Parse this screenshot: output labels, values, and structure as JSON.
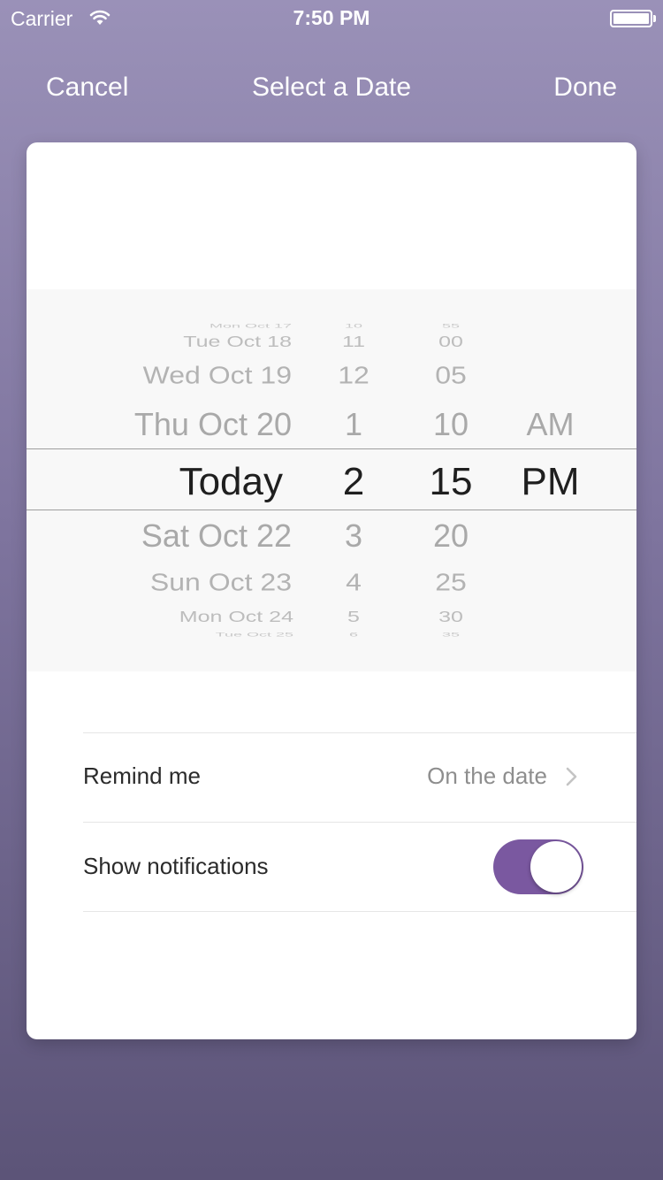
{
  "status_bar": {
    "carrier": "Carrier",
    "time": "7:50 PM",
    "wifi_icon": "wifi-icon",
    "battery_icon": "battery-icon"
  },
  "nav": {
    "cancel": "Cancel",
    "title": "Select a Date",
    "done": "Done"
  },
  "picker": {
    "dates": [
      "Mon Oct 17",
      "Tue Oct 18",
      "Wed Oct 19",
      "Thu Oct 20",
      "Today",
      "Sat Oct 22",
      "Sun Oct 23",
      "Mon Oct 24",
      "Tue Oct 25"
    ],
    "hours": [
      "10",
      "11",
      "12",
      "1",
      "2",
      "3",
      "4",
      "5",
      "6"
    ],
    "minutes": [
      "55",
      "00",
      "05",
      "10",
      "15",
      "20",
      "25",
      "30",
      "35"
    ],
    "ampm": [
      "AM",
      "PM"
    ],
    "selected": {
      "date": "Today",
      "hour": "2",
      "minute": "15",
      "ampm": "PM"
    }
  },
  "settings": {
    "remind": {
      "label": "Remind me",
      "value": "On the date",
      "icon": "chevron-right-icon"
    },
    "notifications": {
      "label": "Show notifications",
      "enabled": true
    }
  },
  "colors": {
    "toggle_on": "#7a58a0",
    "background_top": "#9a91b8",
    "background_bottom": "#5c5478"
  }
}
